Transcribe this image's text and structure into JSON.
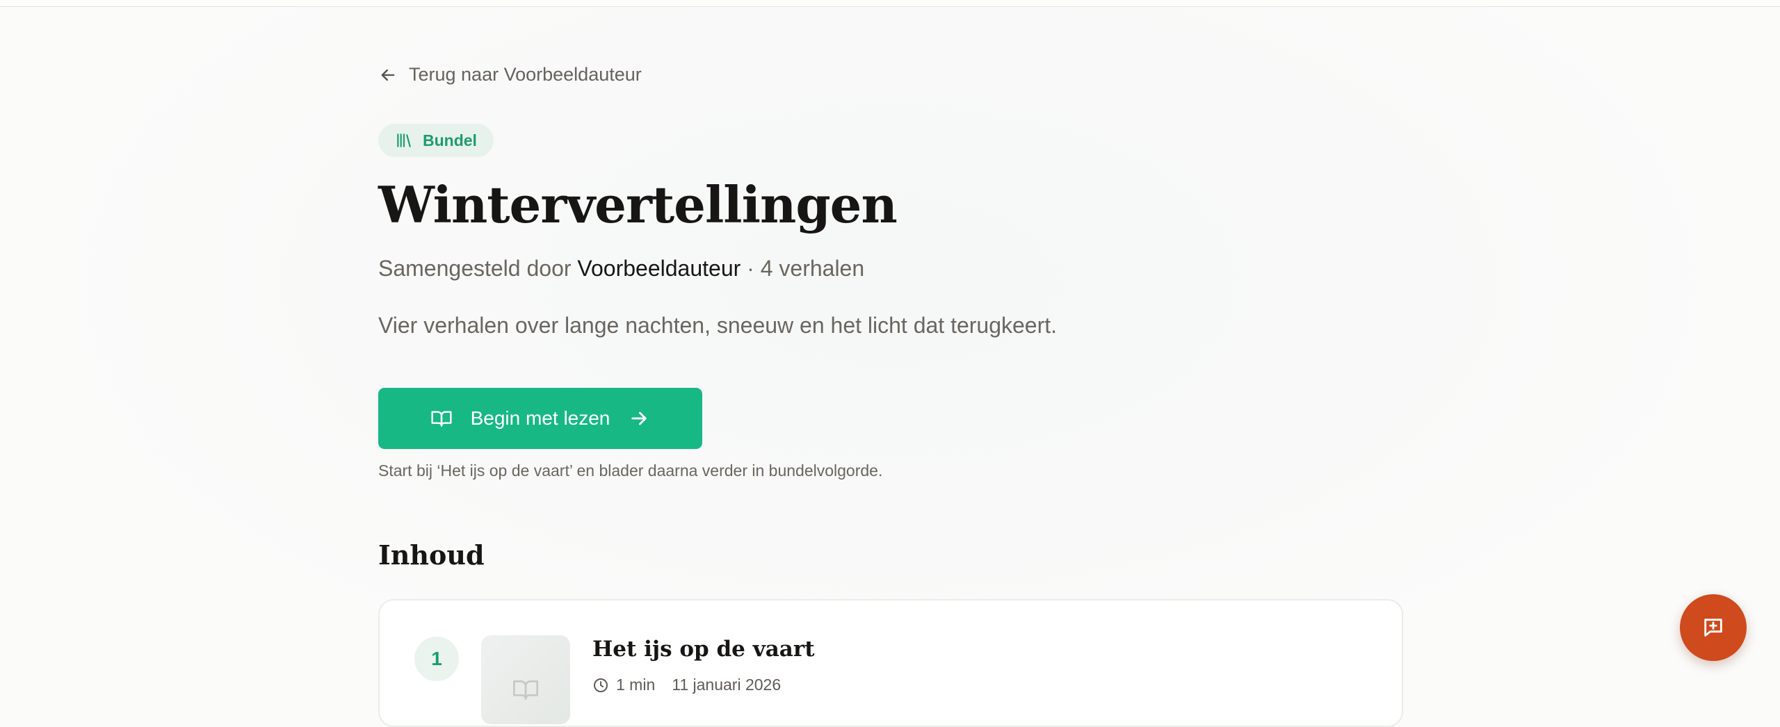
{
  "back_link": {
    "label": "Terug naar Voorbeeldauteur",
    "icon": "arrow-left-icon"
  },
  "badge": {
    "label": "Bundel",
    "icon": "library-icon"
  },
  "collection": {
    "title": "Wintervertellingen",
    "compiled_by_prefix": "Samengesteld door",
    "author": "Voorbeeldauteur",
    "count_text": "· 4 verhalen",
    "description": "Vier verhalen over lange nachten, sneeuw en het licht dat terugkeert."
  },
  "cta": {
    "label": "Begin met lezen",
    "icon": "book-open-icon",
    "trailing_icon": "arrow-right-icon"
  },
  "hint": "Start bij ‘Het ijs op de vaart’ en blader daarna verder in bundelvolgorde.",
  "toc": {
    "heading": "Inhoud",
    "items": [
      {
        "number": "1",
        "title": "Het ijs op de vaart",
        "reading_time": "1 min",
        "date": "11 januari 2026"
      }
    ]
  },
  "fab": {
    "icon": "message-plus-icon"
  },
  "colors": {
    "accent": "#18b884",
    "accent_text": "#1d9c6e",
    "fab": "#cf4a1d",
    "background": "#fbfbfa"
  }
}
